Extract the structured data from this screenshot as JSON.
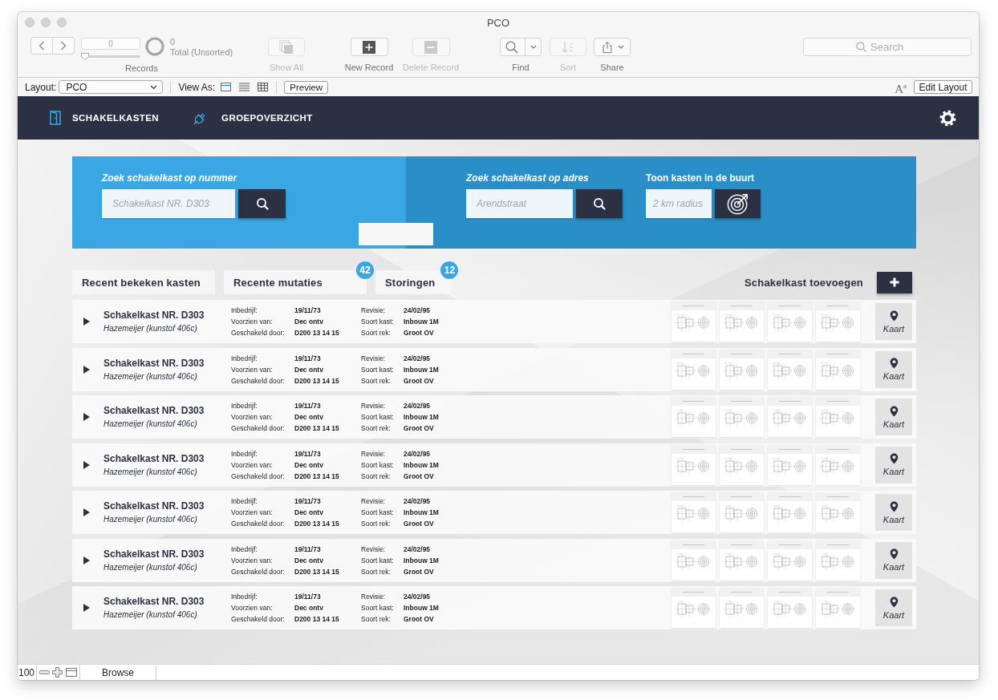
{
  "window": {
    "title": "PCO"
  },
  "toolbar": {
    "record_number": "0",
    "record_slider": {
      "level": 0
    },
    "found_count": "0",
    "total_label": "Total (Unsorted)",
    "records_label": "Records",
    "buttons": [
      {
        "kind": "show_all",
        "label": "Show All",
        "disabled": true
      },
      {
        "kind": "new_record",
        "label": "New Record",
        "disabled": false
      },
      {
        "kind": "delete_record",
        "label": "Delete Record",
        "disabled": true
      },
      {
        "kind": "find",
        "label": "Find",
        "disabled": false
      },
      {
        "kind": "sort",
        "label": "Sort",
        "disabled": true
      },
      {
        "kind": "share",
        "label": "Share",
        "disabled": false
      }
    ],
    "search": {
      "placeholder": "Search"
    }
  },
  "layout_bar": {
    "layout_label": "Layout:",
    "layout_value": "PCO",
    "view_as_label": "View As:",
    "view_modes": [
      {
        "kind": "form",
        "selected": true
      },
      {
        "kind": "list",
        "selected": false
      },
      {
        "kind": "table",
        "selected": false
      }
    ],
    "preview_button": "Preview",
    "text_size_button": "A$^{a}$",
    "edit_layout_button": "Edit Layout"
  },
  "nav": {
    "items": [
      {
        "kind": "door",
        "label": "SCHAKELKASTEN"
      },
      {
        "kind": "plug",
        "label": "GROEPOVERZICHT"
      }
    ]
  },
  "search_panel": {
    "by_number": {
      "label": "Zoek schakelkast op nummer",
      "placeholder": "Schakelkast NR. D303"
    },
    "by_address": {
      "label": "Zoek schakelkast op adres",
      "placeholder": "Arendstraat"
    },
    "nearby": {
      "label": "Toon kasten in de buurt",
      "placeholder": "2 km radius"
    }
  },
  "tabs": [
    {
      "label": "Recent bekeken kasten",
      "selected": false
    },
    {
      "label": "Recente mutaties",
      "badge": "42",
      "selected": false
    },
    {
      "label": "Storingen",
      "badge": "12",
      "selected": false
    }
  ],
  "add_record": {
    "label": "Schakelkast toevoegen"
  },
  "records": [
    {
      "title": "Schakelkast NR. D303",
      "subtitle": "Hazemeijer (kunstof 406c)",
      "expanded": false,
      "details": [
        {
          "label": "Inbedrijf:",
          "value": "19/11/73"
        },
        {
          "label": "Voorzien van:",
          "value": "Dec ontv"
        },
        {
          "label": "Geschakeld door:",
          "value": "D200 13 14 15"
        }
      ],
      "details_2": [
        {
          "label": "Revisie:",
          "value": "24/02/95"
        },
        {
          "label": "Soort kast:",
          "value": "Inbouw 1M"
        },
        {
          "label": "Soort rek:",
          "value": "Groot OV"
        }
      ],
      "attachments": [
        {
          "kind": "blueprint"
        },
        {
          "kind": "blueprint"
        },
        {
          "kind": "blueprint"
        },
        {
          "kind": "blueprint"
        }
      ],
      "map_button": "Kaart"
    },
    {
      "title": "Schakelkast NR. D303",
      "subtitle": "Hazemeijer (kunstof 406c)",
      "expanded": false,
      "details": [
        {
          "label": "Inbedrijf:",
          "value": "19/11/73"
        },
        {
          "label": "Voorzien van:",
          "value": "Dec ontv"
        },
        {
          "label": "Geschakeld door:",
          "value": "D200 13 14 15"
        }
      ],
      "details_2": [
        {
          "label": "Revisie:",
          "value": "24/02/95"
        },
        {
          "label": "Soort kast:",
          "value": "Inbouw 1M"
        },
        {
          "label": "Soort rek:",
          "value": "Groot OV"
        }
      ],
      "attachments": [
        {
          "kind": "blueprint"
        },
        {
          "kind": "blueprint"
        },
        {
          "kind": "blueprint"
        },
        {
          "kind": "blueprint"
        }
      ],
      "map_button": "Kaart"
    },
    {
      "title": "Schakelkast NR. D303",
      "subtitle": "Hazemeijer (kunstof 406c)",
      "expanded": false,
      "details": [
        {
          "label": "Inbedrijf:",
          "value": "19/11/73"
        },
        {
          "label": "Voorzien van:",
          "value": "Dec ontv"
        },
        {
          "label": "Geschakeld door:",
          "value": "D200 13 14 15"
        }
      ],
      "details_2": [
        {
          "label": "Revisie:",
          "value": "24/02/95"
        },
        {
          "label": "Soort kast:",
          "value": "Inbouw 1M"
        },
        {
          "label": "Soort rek:",
          "value": "Groot OV"
        }
      ],
      "attachments": [
        {
          "kind": "blueprint"
        },
        {
          "kind": "blueprint"
        },
        {
          "kind": "blueprint"
        },
        {
          "kind": "blueprint"
        }
      ],
      "map_button": "Kaart"
    },
    {
      "title": "Schakelkast NR. D303",
      "subtitle": "Hazemeijer (kunstof 406c)",
      "expanded": false,
      "details": [
        {
          "label": "Inbedrijf:",
          "value": "19/11/73"
        },
        {
          "label": "Voorzien van:",
          "value": "Dec ontv"
        },
        {
          "label": "Geschakeld door:",
          "value": "D200 13 14 15"
        }
      ],
      "details_2": [
        {
          "label": "Revisie:",
          "value": "24/02/95"
        },
        {
          "label": "Soort kast:",
          "value": "Inbouw 1M"
        },
        {
          "label": "Soort rek:",
          "value": "Groot OV"
        }
      ],
      "attachments": [
        {
          "kind": "blueprint"
        },
        {
          "kind": "blueprint"
        },
        {
          "kind": "blueprint"
        },
        {
          "kind": "blueprint"
        }
      ],
      "map_button": "Kaart"
    },
    {
      "title": "Schakelkast NR. D303",
      "subtitle": "Hazemeijer (kunstof 406c)",
      "expanded": false,
      "details": [
        {
          "label": "Inbedrijf:",
          "value": "19/11/73"
        },
        {
          "label": "Voorzien van:",
          "value": "Dec ontv"
        },
        {
          "label": "Geschakeld door:",
          "value": "D200 13 14 15"
        }
      ],
      "details_2": [
        {
          "label": "Revisie:",
          "value": "24/02/95"
        },
        {
          "label": "Soort kast:",
          "value": "Inbouw 1M"
        },
        {
          "label": "Soort rek:",
          "value": "Groot OV"
        }
      ],
      "attachments": [
        {
          "kind": "blueprint"
        },
        {
          "kind": "blueprint"
        },
        {
          "kind": "blueprint"
        },
        {
          "kind": "blueprint"
        }
      ],
      "map_button": "Kaart"
    },
    {
      "title": "Schakelkast NR. D303",
      "subtitle": "Hazemeijer (kunstof 406c)",
      "expanded": false,
      "details": [
        {
          "label": "Inbedrijf:",
          "value": "19/11/73"
        },
        {
          "label": "Voorzien van:",
          "value": "Dec ontv"
        },
        {
          "label": "Geschakeld door:",
          "value": "D200 13 14 15"
        }
      ],
      "details_2": [
        {
          "label": "Revisie:",
          "value": "24/02/95"
        },
        {
          "label": "Soort kast:",
          "value": "Inbouw 1M"
        },
        {
          "label": "Soort rek:",
          "value": "Groot OV"
        }
      ],
      "attachments": [
        {
          "kind": "blueprint"
        },
        {
          "kind": "blueprint"
        },
        {
          "kind": "blueprint"
        },
        {
          "kind": "blueprint"
        }
      ],
      "map_button": "Kaart"
    },
    {
      "title": "Schakelkast NR. D303",
      "subtitle": "Hazemeijer (kunstof 406c)",
      "expanded": false,
      "details": [
        {
          "label": "Inbedrijf:",
          "value": "19/11/73"
        },
        {
          "label": "Voorzien van:",
          "value": "Dec ontv"
        },
        {
          "label": "Geschakeld door:",
          "value": "D200 13 14 15"
        }
      ],
      "details_2": [
        {
          "label": "Revisie:",
          "value": "24/02/95"
        },
        {
          "label": "Soort kast:",
          "value": "Inbouw 1M"
        },
        {
          "label": "Soort rek:",
          "value": "Groot OV"
        }
      ],
      "attachments": [
        {
          "kind": "blueprint"
        },
        {
          "kind": "blueprint"
        },
        {
          "kind": "blueprint"
        },
        {
          "kind": "blueprint"
        }
      ],
      "map_button": "Kaart"
    }
  ],
  "status_bar": {
    "zoom": "100",
    "mode": "Browse"
  }
}
